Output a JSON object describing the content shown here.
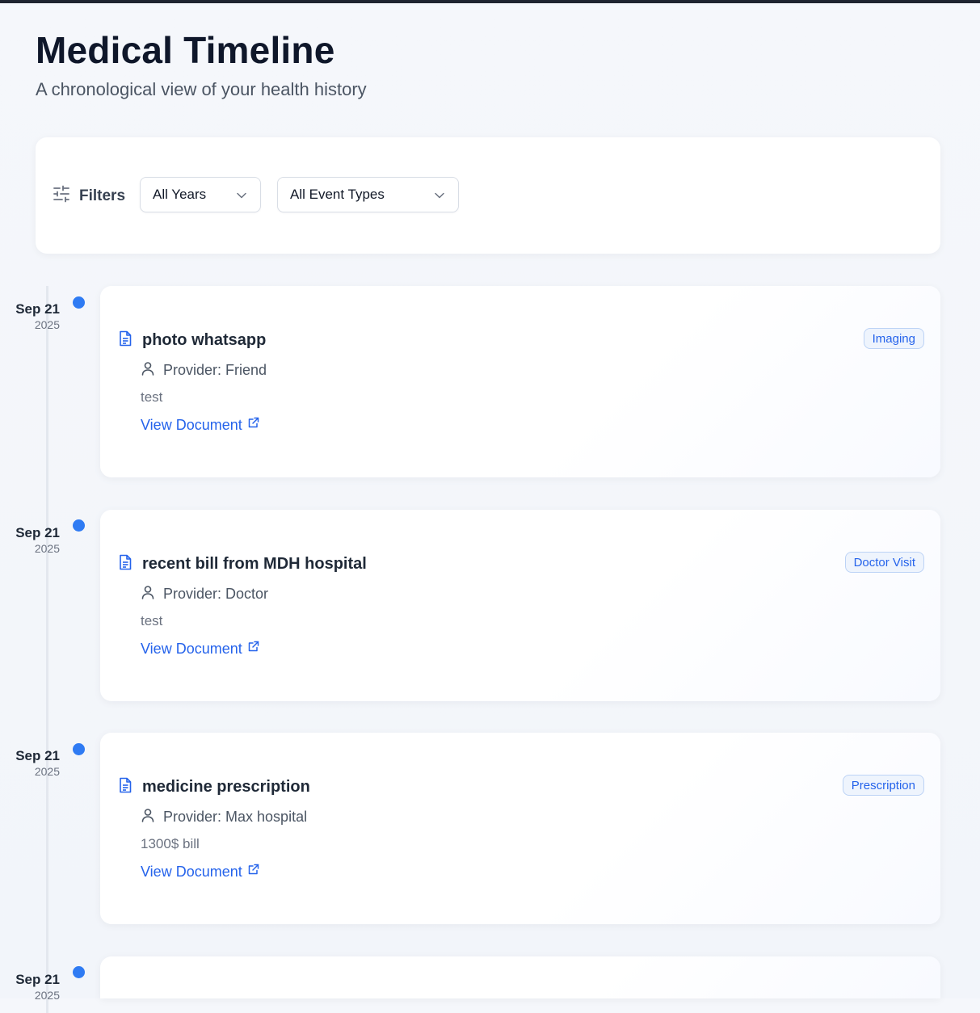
{
  "header": {
    "title": "Medical Timeline",
    "subtitle": "A chronological view of your health history"
  },
  "filters": {
    "label": "Filters",
    "year_select": {
      "value": "All Years"
    },
    "type_select": {
      "value": "All Event Types"
    }
  },
  "colors": {
    "accent": "#2f7bf3",
    "link": "#2563eb",
    "badge_bg": "#eef4fd",
    "badge_border": "#bcd3f6"
  },
  "events": [
    {
      "date_day": "Sep 21",
      "date_year": "2025",
      "title": "photo whatsapp",
      "type": "Imaging",
      "provider": "Provider: Friend",
      "note": "test",
      "link_label": "View Document",
      "icon": "document-icon"
    },
    {
      "date_day": "Sep 21",
      "date_year": "2025",
      "title": "recent bill from MDH hospital",
      "type": "Doctor Visit",
      "provider": "Provider: Doctor",
      "note": "test",
      "link_label": "View Document",
      "icon": "document-icon"
    },
    {
      "date_day": "Sep 21",
      "date_year": "2025",
      "title": "medicine prescription",
      "type": "Prescription",
      "provider": "Provider: Max hospital",
      "note": "1300$ bill",
      "link_label": "View Document",
      "icon": "document-icon"
    },
    {
      "date_day": "Sep 21",
      "date_year": "2025"
    }
  ]
}
